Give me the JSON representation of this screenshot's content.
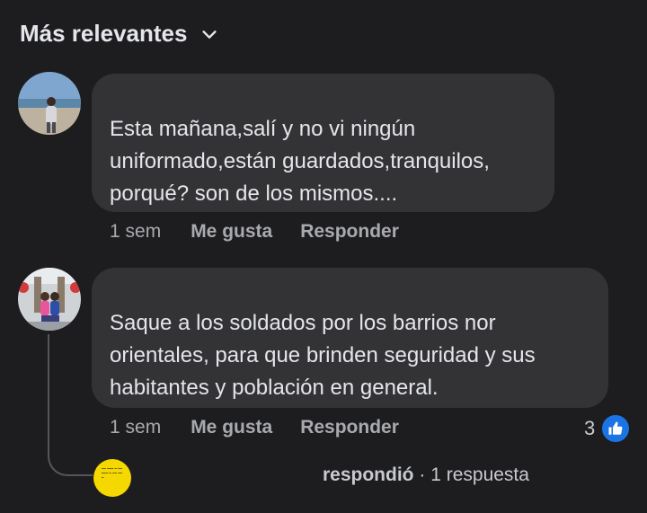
{
  "sort": {
    "label": "Más relevantes"
  },
  "comments": [
    {
      "lines": [
        "Esta mañana,salí y no vi ningún",
        "uniformado,están guardados,tranquilos,",
        "porqué? son de los mismos...."
      ],
      "time": "1 sem",
      "like_label": "Me gusta",
      "reply_label": "Responder"
    },
    {
      "lines": [
        "Saque a los soldados por los barrios nor",
        "orientales,  para que brinden seguridad y sus",
        "habitantes  y población en general."
      ],
      "time": "1 sem",
      "like_label": "Me gusta",
      "reply_label": "Responder",
      "reaction_count": "3"
    }
  ],
  "replies": {
    "author_suffix": "respondió",
    "separator": "·",
    "count_label": "1 respuesta"
  },
  "colors": {
    "background": "#1d1d1f",
    "bubble": "#333336",
    "like_blue": "#1b74e4",
    "reply_avatar": "#f5d800"
  },
  "icons": {
    "sort": "chevron-down-icon",
    "reaction": "thumbs-up-icon"
  }
}
